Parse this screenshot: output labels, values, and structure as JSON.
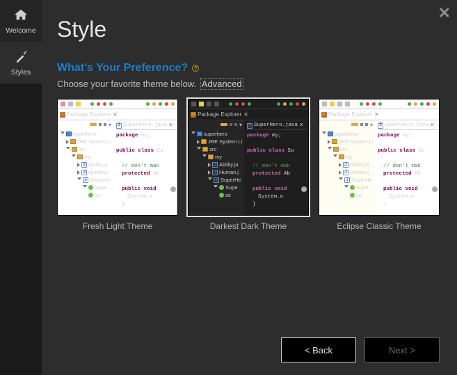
{
  "sidebar": {
    "tabs": [
      {
        "label": "Welcome"
      },
      {
        "label": "Styles"
      }
    ]
  },
  "header": {
    "title": "Style"
  },
  "preference": {
    "question": "What's Your Preference?",
    "description_prefix": "Choose your favorite theme below. ",
    "advanced_label": "Advanced"
  },
  "themes": [
    {
      "caption": "Fresh Light Theme",
      "selected": false
    },
    {
      "caption": "Darkest Dark Theme",
      "selected": true
    },
    {
      "caption": "Eclipse Classic Theme",
      "selected": false
    }
  ],
  "thumb": {
    "package_explorer_label": "Package Explorer",
    "editor_tab_label": "SuperHero.java",
    "tree": {
      "project": "superhero",
      "jre": "JRE System Li",
      "src": "src",
      "pkg": "my",
      "files": [
        "Ability.ja",
        "Human.j",
        "SuperHe"
      ],
      "class": "Supe",
      "member": "se"
    },
    "code": {
      "l1a": "package",
      "l1b": " my;",
      "l2a": "public class ",
      "l2b": "Su",
      "l3": "// don't mak",
      "l4a": "protected ",
      "l4b": "Ab",
      "l5a": "public void",
      "l5b": "",
      "l6": "System.o",
      "l7": "}"
    }
  },
  "buttons": {
    "back": "< Back",
    "next": "Next >"
  }
}
